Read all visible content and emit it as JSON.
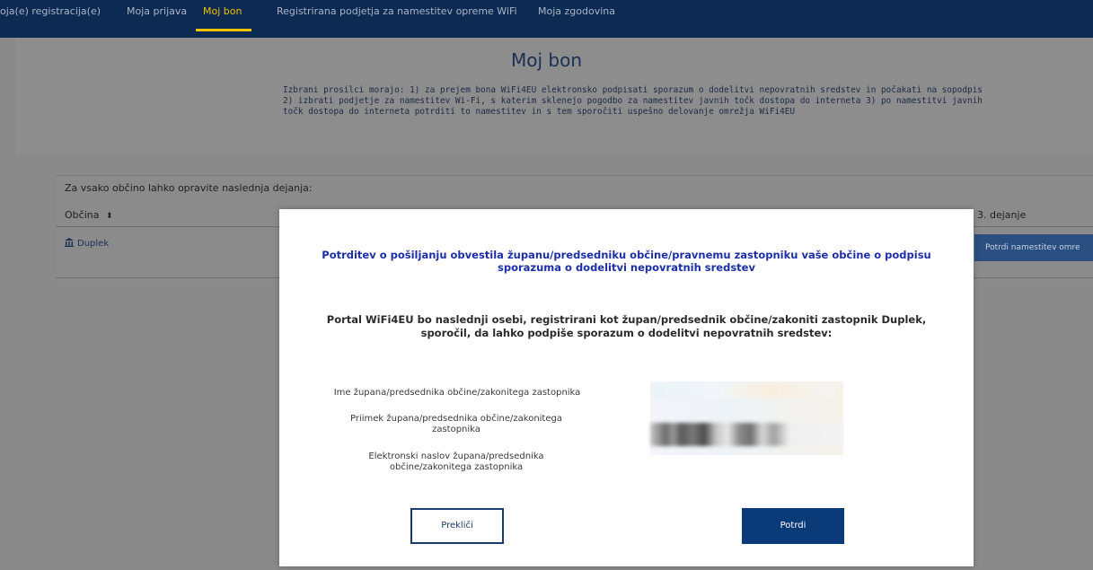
{
  "nav": {
    "items": [
      {
        "label": "oja(e) registracija(e)"
      },
      {
        "label": "Moja prijava"
      },
      {
        "label": "Moj bon",
        "active": true
      },
      {
        "label": "Registrirana podjetja za namestitev opreme WiFi"
      },
      {
        "label": "Moja zgodovina"
      }
    ]
  },
  "page": {
    "title": "Moj bon",
    "intro": "Izbrani prosilci morajo: 1) za prejem bona WiFi4EU elektronsko podpisati sporazum o dodelitvi nepovratnih sredstev in počakati na sopodpis 2) izbrati podjetje za namestitev Wi-Fi, s katerim sklenejo pogodbo za namestitev javnih točk dostopa do interneta 3) po namestitvi javnih točk dostopa do interneta potrditi to namestitev in s tem sporočiti uspešno delovanje omrežja WiFi4EU"
  },
  "actions": {
    "caption": "Za vsako občino lahko opravite naslednja dejanja:",
    "col_municipality": "Občina",
    "col_step3": "3. dejanje",
    "rows": [
      {
        "municipality": "Duplek",
        "step3_button": "Potrdi namestitev omre"
      }
    ]
  },
  "modal": {
    "title": "Potrditev o pošiljanju obvestila županu/predsedniku občine/pravnemu zastopniku vaše občine o podpisu sporazuma o dodelitvi nepovratnih sredstev",
    "body": "Portal WiFi4EU bo naslednji osebi, registrirani kot župan/predsednik občine/zakoniti zastopnik Duplek, sporočil, da lahko podpiše sporazum o dodelitvi nepovratnih sredstev:",
    "label_name": "Ime župana/predsednika občine/zakonitega zastopnika",
    "label_surname": "Priimek župana/predsednika občine/zakonitega zastopnika",
    "label_email": "Elektronski naslov župana/predsednika občine/zakonitega zastopnika",
    "cancel_label": "Prekliči",
    "confirm_label": "Potrdi"
  },
  "colors": {
    "nav_bg": "#0d2a52",
    "accent": "#f2c100",
    "primary_button": "#0b3a78",
    "modal_title": "#1d2fa8"
  }
}
